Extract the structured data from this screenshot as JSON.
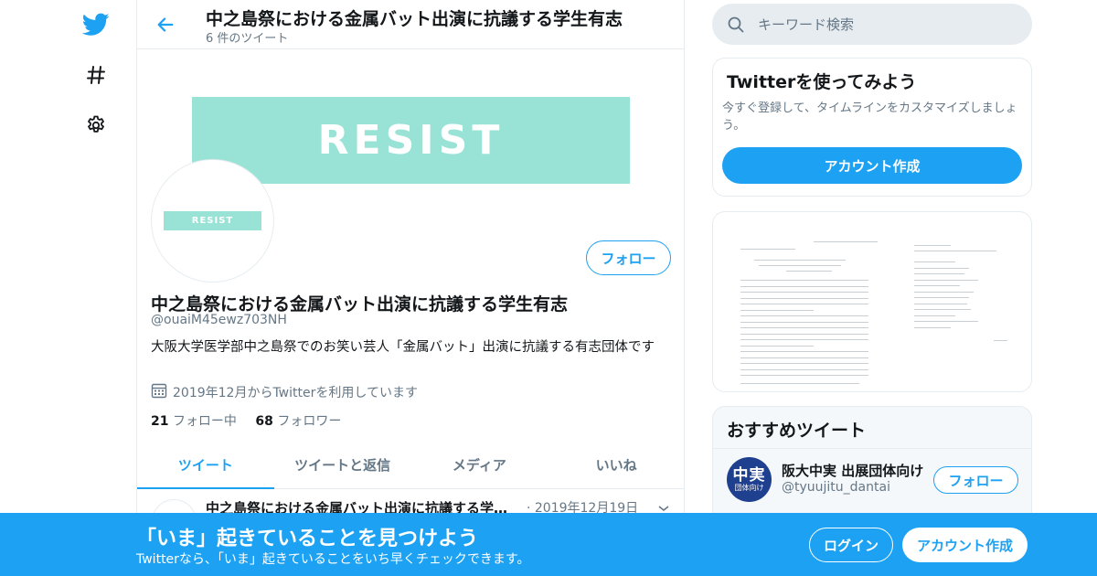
{
  "colors": {
    "brand": "#1da1f2",
    "banner": "#98e3d5",
    "text_secondary": "#657786"
  },
  "nav": {
    "items": [
      "twitter-logo-icon",
      "hashtag-icon",
      "gear-icon"
    ]
  },
  "header": {
    "title": "中之島祭における金属バット出演に抗議する学生有志",
    "subtitle": "6 件のツイート"
  },
  "profile": {
    "banner_text": "RESIST",
    "avatar_text": "RESIST",
    "follow_label": "フォロー",
    "name": "中之島祭における金属バット出演に抗議する学生有志",
    "handle": "@ouaiM45ewz703NH",
    "bio": "大阪大学医学部中之島祭でのお笑い芸人「金属バット」出演に抗議する有志団体です",
    "joined": "2019年12月からTwitterを利用しています",
    "following_count": "21",
    "following_label": "フォロー中",
    "followers_count": "68",
    "followers_label": "フォロワー"
  },
  "tabs": [
    {
      "label": "ツイート",
      "active": true
    },
    {
      "label": "ツイートと返信",
      "active": false
    },
    {
      "label": "メディア",
      "active": false
    },
    {
      "label": "いいね",
      "active": false
    }
  ],
  "tweet": {
    "name": "中之島祭における金属バット出演に抗議する学生有志",
    "date": "· 2019年12月19日"
  },
  "search": {
    "placeholder": "キーワード検索"
  },
  "signup_card": {
    "title": "Twitterを使ってみよう",
    "text": "今すぐ登録して、タイムラインをカスタマイズしましょう。",
    "button": "アカウント作成"
  },
  "reco": {
    "title": "おすすめツイート",
    "avatar_big": "中実",
    "avatar_small": "団体向け",
    "name": "阪大中実 出展団体向け",
    "handle": "@tyuujitu_dantai",
    "follow_label": "フォロー"
  },
  "bottom": {
    "title": "「いま」起きていることを見つけよう",
    "subtitle": "Twitterなら、「いま」起きていることをいち早くチェックできます。",
    "login": "ログイン",
    "signup": "アカウント作成"
  }
}
